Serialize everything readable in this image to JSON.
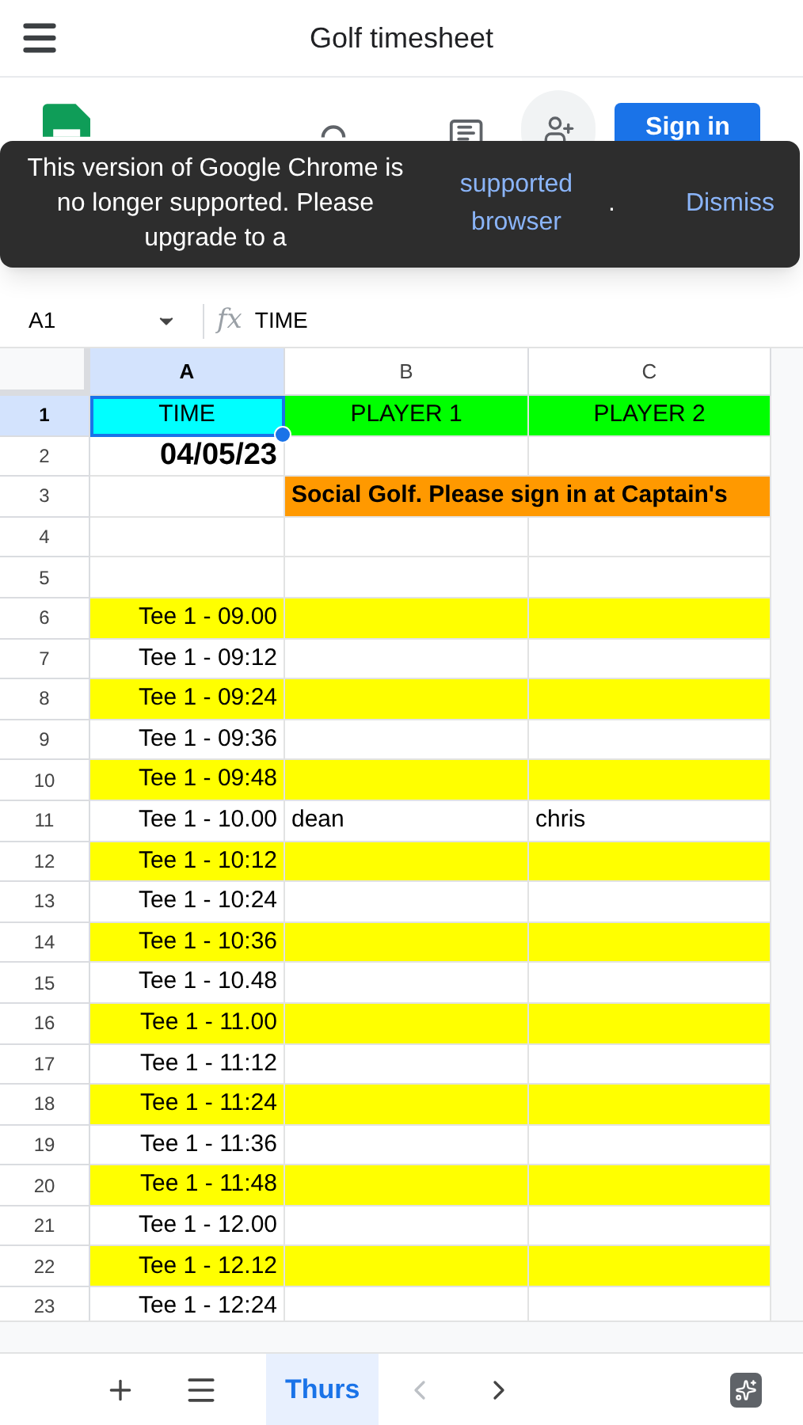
{
  "title": "Golf timesheet",
  "app_bar": {
    "sign_in": "Sign in"
  },
  "toast": {
    "message": "This version of Google Chrome is no longer supported. Please upgrade to a",
    "link": "supported browser",
    "period": ".",
    "dismiss": "Dismiss"
  },
  "formula_bar": {
    "cell": "A1",
    "fx": "fx",
    "value": "TIME"
  },
  "columns": [
    {
      "label": "A",
      "selected": true
    },
    {
      "label": "B",
      "selected": false
    },
    {
      "label": "C",
      "selected": false
    }
  ],
  "rows": [
    {
      "number": "1",
      "selected": true,
      "kind": "header",
      "cells": [
        {
          "text": "TIME",
          "color": "#00ffff"
        },
        {
          "text": "PLAYER 1",
          "color": "#00ff00"
        },
        {
          "text": "PLAYER 2",
          "color": "#00ff00"
        }
      ]
    },
    {
      "number": "2",
      "selected": false,
      "kind": "date",
      "cells": [
        {
          "text": "04/05/23"
        },
        {},
        {}
      ]
    },
    {
      "number": "3",
      "selected": false,
      "kind": "note",
      "cells": [
        {},
        {
          "text": "Social Golf. Please sign in at Captain's",
          "color": "#ff9900"
        }
      ]
    },
    {
      "number": "4",
      "selected": false,
      "kind": "slot",
      "cells": [
        {},
        {},
        {}
      ]
    },
    {
      "number": "5",
      "selected": false,
      "kind": "slot",
      "cells": [
        {},
        {},
        {}
      ]
    },
    {
      "number": "6",
      "selected": false,
      "kind": "slot",
      "cells": [
        {
          "text": "Tee 1  - 09.00",
          "color": "#ffff00"
        },
        {
          "color": "#ffff00"
        },
        {
          "color": "#ffff00"
        }
      ]
    },
    {
      "number": "7",
      "selected": false,
      "kind": "slot",
      "cells": [
        {
          "text": "Tee 1  - 09:12"
        },
        {},
        {}
      ]
    },
    {
      "number": "8",
      "selected": false,
      "kind": "slot",
      "cells": [
        {
          "text": "Tee 1  - 09:24",
          "color": "#ffff00"
        },
        {
          "color": "#ffff00"
        },
        {
          "color": "#ffff00"
        }
      ]
    },
    {
      "number": "9",
      "selected": false,
      "kind": "slot",
      "cells": [
        {
          "text": "Tee 1  - 09:36"
        },
        {},
        {}
      ]
    },
    {
      "number": "10",
      "selected": false,
      "kind": "slot",
      "cells": [
        {
          "text": "Tee 1  - 09:48",
          "color": "#ffff00"
        },
        {
          "color": "#ffff00"
        },
        {
          "color": "#ffff00"
        }
      ]
    },
    {
      "number": "11",
      "selected": false,
      "kind": "slot",
      "cells": [
        {
          "text": "Tee 1  - 10.00"
        },
        {
          "text": "dean"
        },
        {
          "text": "chris"
        }
      ]
    },
    {
      "number": "12",
      "selected": false,
      "kind": "slot",
      "cells": [
        {
          "text": "Tee 1  - 10:12",
          "color": "#ffff00"
        },
        {
          "color": "#ffff00"
        },
        {
          "color": "#ffff00"
        }
      ]
    },
    {
      "number": "13",
      "selected": false,
      "kind": "slot",
      "cells": [
        {
          "text": "Tee 1  - 10:24"
        },
        {},
        {}
      ]
    },
    {
      "number": "14",
      "selected": false,
      "kind": "slot",
      "cells": [
        {
          "text": "Tee 1  - 10:36",
          "color": "#ffff00"
        },
        {
          "color": "#ffff00"
        },
        {
          "color": "#ffff00"
        }
      ]
    },
    {
      "number": "15",
      "selected": false,
      "kind": "slot",
      "cells": [
        {
          "text": "Tee 1  - 10.48"
        },
        {},
        {}
      ]
    },
    {
      "number": "16",
      "selected": false,
      "kind": "slot",
      "cells": [
        {
          "text": "Tee 1  - 11.00",
          "color": "#ffff00"
        },
        {
          "color": "#ffff00"
        },
        {
          "color": "#ffff00"
        }
      ]
    },
    {
      "number": "17",
      "selected": false,
      "kind": "slot",
      "cells": [
        {
          "text": "Tee 1  - 11:12"
        },
        {},
        {}
      ]
    },
    {
      "number": "18",
      "selected": false,
      "kind": "slot",
      "cells": [
        {
          "text": "Tee 1  - 11:24",
          "color": "#ffff00"
        },
        {
          "color": "#ffff00"
        },
        {
          "color": "#ffff00"
        }
      ]
    },
    {
      "number": "19",
      "selected": false,
      "kind": "slot",
      "cells": [
        {
          "text": "Tee 1  - 11:36"
        },
        {},
        {}
      ]
    },
    {
      "number": "20",
      "selected": false,
      "kind": "slot",
      "cells": [
        {
          "text": "Tee 1  - 11:48",
          "color": "#ffff00"
        },
        {
          "color": "#ffff00"
        },
        {
          "color": "#ffff00"
        }
      ]
    },
    {
      "number": "21",
      "selected": false,
      "kind": "slot",
      "cells": [
        {
          "text": "Tee 1  - 12.00"
        },
        {},
        {}
      ]
    },
    {
      "number": "22",
      "selected": false,
      "kind": "slot",
      "cells": [
        {
          "text": "Tee 1  - 12.12",
          "color": "#ffff00"
        },
        {
          "color": "#ffff00"
        },
        {
          "color": "#ffff00"
        }
      ]
    },
    {
      "number": "23",
      "selected": false,
      "kind": "slot",
      "cells": [
        {
          "text": "Tee 1  - 12:24"
        },
        {},
        {}
      ]
    }
  ],
  "sheet_tabs": [
    {
      "label": "Thurs",
      "selected": true
    }
  ]
}
